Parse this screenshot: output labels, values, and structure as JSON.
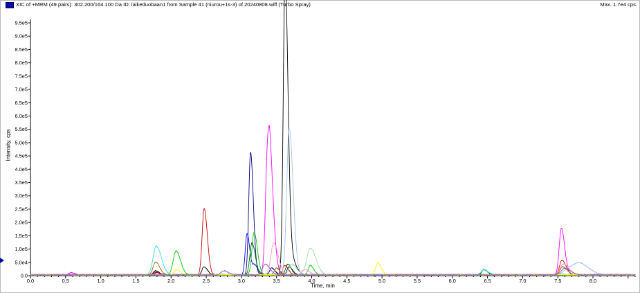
{
  "header": {
    "title": "XIC of +MRM (49 pairs): 302.200/164.100 Da ID: laikeduobaan1 from Sample 41 (niurou+1s-3) of 20240808.wiff (Turbo Spray)",
    "max": "Max. 1.7e4 cps."
  },
  "chart_data": {
    "type": "line",
    "xlabel": "Time, min",
    "ylabel": "Intensity, cps",
    "xlim": [
      0.0,
      8.6
    ],
    "ylim": [
      0,
      950000
    ],
    "x_ticks": [
      0.0,
      0.5,
      1.0,
      1.5,
      2.0,
      2.5,
      3.0,
      3.5,
      4.0,
      4.5,
      5.0,
      5.5,
      6.0,
      6.5,
      7.0,
      7.5,
      8.0
    ],
    "x_tick_labels": [
      "0.0",
      "0.5",
      "1.0",
      "1.5",
      "2.0",
      "2.5",
      "3.0",
      "3.5",
      "4.0",
      "4.5",
      "5.0",
      "5.5",
      "6.0",
      "6.5",
      "7.0",
      "7.5",
      "8.0"
    ],
    "y_ticks": [
      0,
      50000,
      100000,
      150000,
      200000,
      250000,
      300000,
      350000,
      400000,
      450000,
      500000,
      550000,
      600000,
      650000,
      700000,
      750000,
      800000,
      850000,
      900000,
      950000
    ],
    "y_tick_labels": [
      "0.0",
      "5.0e4",
      "1.0e5",
      "1.5e5",
      "2.0e5",
      "2.5e5",
      "3.0e5",
      "3.5e5",
      "4.0e5",
      "4.5e5",
      "5.0e5",
      "5.5e5",
      "6.0e5",
      "6.5e5",
      "7.0e5",
      "7.5e5",
      "8.0e5",
      "8.5e5",
      "9.0e5",
      "9.5e5"
    ],
    "series": [
      {
        "color": "#000000",
        "peaks": [
          [
            3.62,
            945000,
            0.025
          ],
          [
            3.63,
            190000,
            0.03
          ],
          [
            2.47,
            30000,
            0.03
          ],
          [
            3.72,
            50000,
            0.04
          ],
          [
            1.78,
            15000,
            0.03
          ]
        ]
      },
      {
        "color": "#00007a",
        "peaks": [
          [
            3.13,
            460000,
            0.025
          ],
          [
            3.68,
            30000,
            0.03
          ],
          [
            3.43,
            25000,
            0.03
          ]
        ]
      },
      {
        "color": "#0000ff",
        "peaks": [
          [
            3.08,
            155000,
            0.025
          ],
          [
            3.19,
            35000,
            0.03
          ],
          [
            1.8,
            8000,
            0.03
          ]
        ]
      },
      {
        "color": "#ff00ff",
        "peaks": [
          [
            3.37,
            365000,
            0.03
          ],
          [
            3.41,
            265000,
            0.035
          ],
          [
            7.55,
            175000,
            0.03
          ],
          [
            0.58,
            8000,
            0.03
          ]
        ]
      },
      {
        "color": "#cc0000",
        "peaks": [
          [
            2.47,
            250000,
            0.028
          ],
          [
            3.62,
            35000,
            0.03
          ],
          [
            7.56,
            55000,
            0.035
          ],
          [
            1.78,
            10000,
            0.03
          ]
        ]
      },
      {
        "color": "#a0c4e8",
        "peaks": [
          [
            3.68,
            550000,
            0.035
          ],
          [
            7.82,
            40000,
            0.08
          ],
          [
            7.65,
            25000,
            0.06
          ]
        ]
      },
      {
        "color": "#00cc00",
        "peaks": [
          [
            3.18,
            160000,
            0.03
          ],
          [
            2.07,
            90000,
            0.04
          ],
          [
            3.98,
            35000,
            0.03
          ]
        ]
      },
      {
        "color": "#ff99cc",
        "peaks": [
          [
            3.46,
            120000,
            0.04
          ],
          [
            7.58,
            40000,
            0.05
          ],
          [
            3.9,
            20000,
            0.04
          ]
        ]
      },
      {
        "color": "#006600",
        "peaks": [
          [
            3.15,
            120000,
            0.03
          ],
          [
            3.66,
            40000,
            0.03
          ],
          [
            6.45,
            20000,
            0.03
          ]
        ]
      },
      {
        "color": "#33dddd",
        "peaks": [
          [
            1.79,
            108000,
            0.045
          ],
          [
            6.45,
            18000,
            0.04
          ]
        ]
      },
      {
        "color": "#996600",
        "peaks": [
          [
            1.78,
            48000,
            0.035
          ],
          [
            3.5,
            25000,
            0.03
          ],
          [
            7.57,
            30000,
            0.04
          ]
        ]
      },
      {
        "color": "#a0e0a0",
        "peaks": [
          [
            3.98,
            100000,
            0.05
          ],
          [
            3.72,
            40000,
            0.04
          ]
        ]
      },
      {
        "color": "#ffff00",
        "peaks": [
          [
            4.94,
            45000,
            0.03
          ],
          [
            2.08,
            20000,
            0.03
          ]
        ]
      },
      {
        "color": "#9966cc",
        "peaks": [
          [
            3.34,
            40000,
            0.04
          ],
          [
            7.6,
            25000,
            0.05
          ],
          [
            2.75,
            15000,
            0.04
          ]
        ]
      }
    ]
  }
}
